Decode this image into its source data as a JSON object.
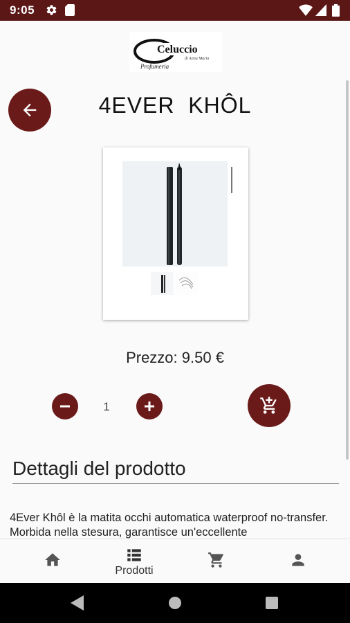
{
  "status_bar": {
    "time": "9:05",
    "icons": [
      "gear-icon",
      "sd-card-icon",
      "wifi-icon",
      "signal-icon",
      "battery-icon"
    ]
  },
  "header": {
    "logo_text": "Celuccio",
    "logo_subtext": "Profumeria",
    "logo_signature": "di Anna Maria",
    "back_icon": "arrow-left-icon",
    "title": "4EVER  KHÔL"
  },
  "product": {
    "image_alt": "4Ever Khôl automatic eye pencil",
    "thumbnail_count": 2,
    "price_label": "Prezzo: 9.50 €",
    "quantity": "1"
  },
  "actions": {
    "decrease_icon": "minus-icon",
    "increase_icon": "plus-icon",
    "cart_icon": "add-to-cart-icon"
  },
  "details": {
    "title": "Dettagli del prodotto",
    "description": "4Ever Khôl è la matita occhi automatica waterproof no-transfer. Morbida nella stesura, garantisce un'eccellente"
  },
  "bottom_nav": {
    "items": [
      {
        "label": "",
        "icon": "home-icon"
      },
      {
        "label": "Prodotti",
        "icon": "list-icon"
      },
      {
        "label": "",
        "icon": "cart-icon"
      },
      {
        "label": "",
        "icon": "person-icon"
      }
    ]
  },
  "colors": {
    "primary": "#6b1a1a",
    "status_bar": "#5b1616",
    "background": "#fafafa"
  }
}
